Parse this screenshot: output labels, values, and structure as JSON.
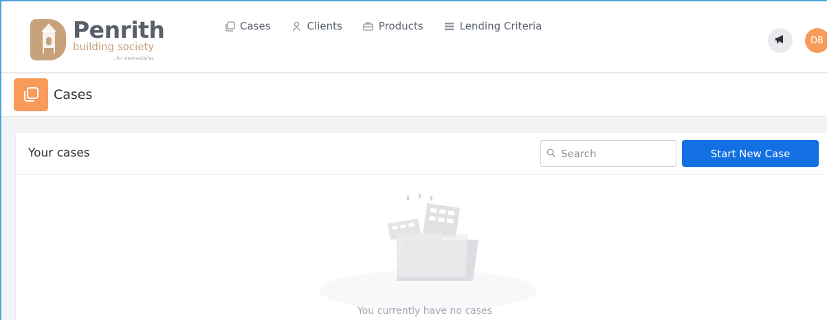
{
  "brand": {
    "name": "Penrith",
    "subtitle": "building society",
    "tagline": "...for intermediaries"
  },
  "nav": {
    "items": [
      {
        "label": "Cases",
        "icon": "cases-icon"
      },
      {
        "label": "Clients",
        "icon": "person-icon"
      },
      {
        "label": "Products",
        "icon": "briefcase-icon"
      },
      {
        "label": "Lending Criteria",
        "icon": "list-icon"
      }
    ]
  },
  "user": {
    "initials": "DB"
  },
  "page": {
    "title": "Cases"
  },
  "cases_panel": {
    "title": "Your cases",
    "search_placeholder": "Search",
    "start_button": "Start New Case",
    "empty_message": "You currently have no cases"
  },
  "colors": {
    "accent_orange": "#f79a5a",
    "primary_blue": "#1270e3",
    "brand_gold": "#c6a17a",
    "brand_grey": "#5a5f6b"
  }
}
